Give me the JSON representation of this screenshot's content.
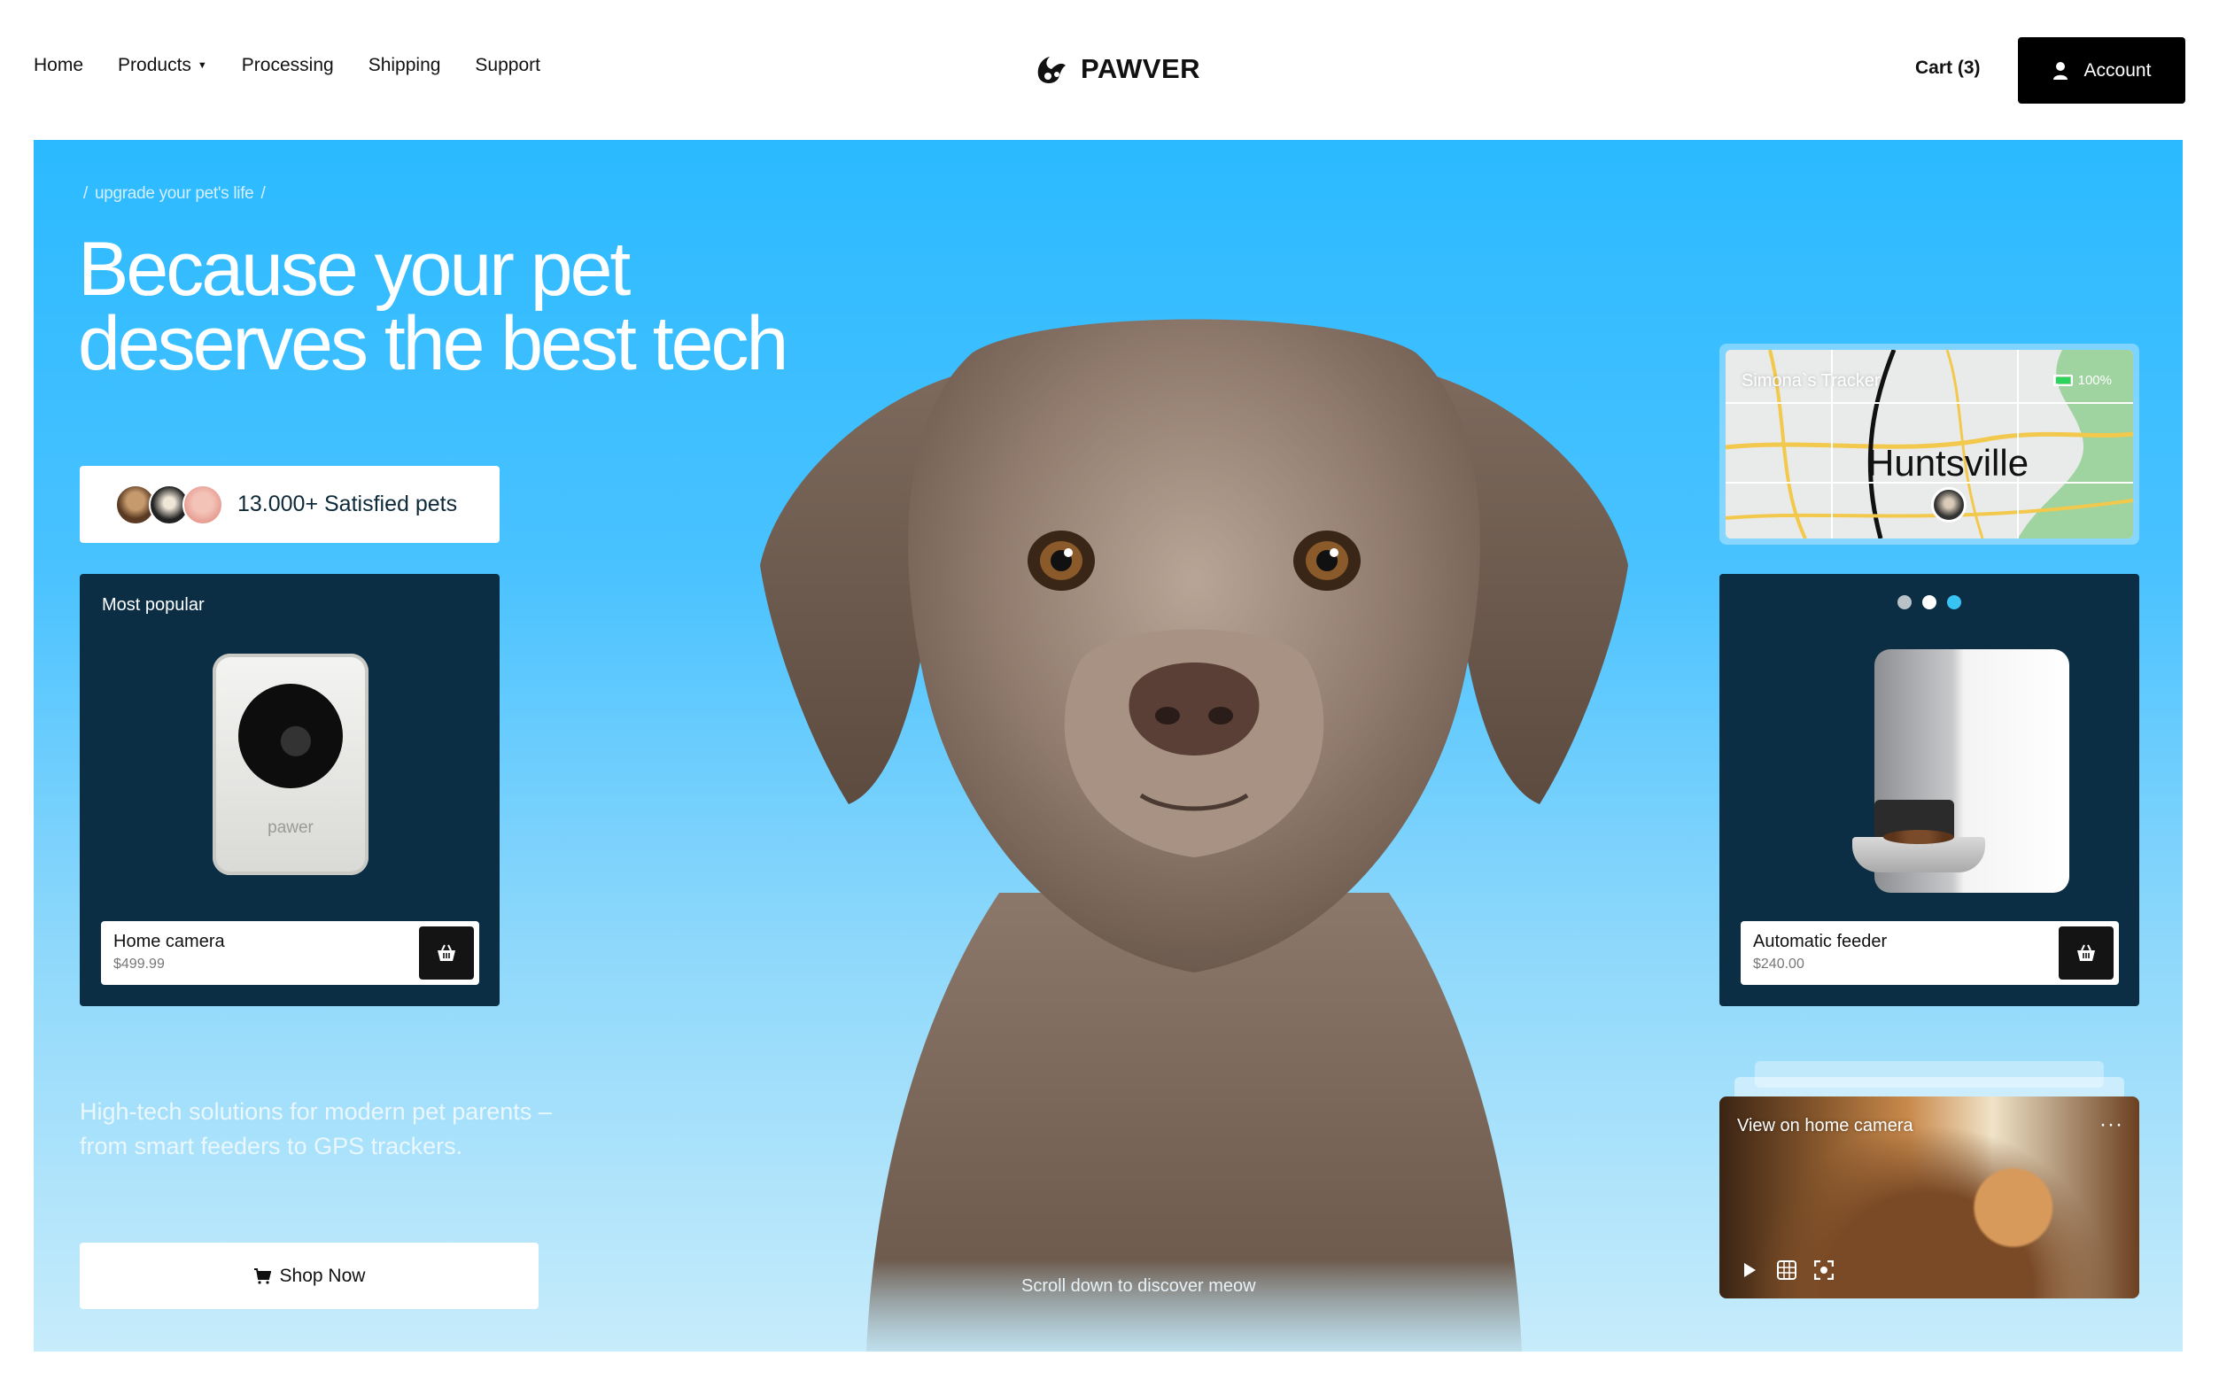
{
  "nav": {
    "items": [
      "Home",
      "Products",
      "Processing",
      "Shipping",
      "Support"
    ]
  },
  "brand": {
    "name": "PAWVER"
  },
  "header": {
    "cart_label": "Cart (3)",
    "account_label": "Account"
  },
  "hero": {
    "breadcrumb": [
      "/",
      "upgrade your pet's life",
      "/"
    ],
    "headline_line1": "Because your pet",
    "headline_line2": "deserves the best tech",
    "satisfied_pets": "13.000+ Satisfied pets",
    "tagline": "High-tech solutions for modern pet parents – from smart feeders to GPS trackers.",
    "shop_label": "Shop Now",
    "scroll_hint": "Scroll down to discover meow"
  },
  "products": {
    "left": {
      "tag": "Most popular",
      "name": "Home camera",
      "price": "$499.99",
      "device_brand": "pawer"
    },
    "right": {
      "name": "Automatic feeder",
      "price": "$240.00"
    }
  },
  "tracker": {
    "title": "Simona`s Tracker",
    "battery": "100%",
    "city": "Huntsville"
  },
  "video": {
    "title": "View on home camera",
    "more": "···"
  },
  "colors": {
    "hero_top": "#2bbaff",
    "hero_bottom": "#c7ecfb",
    "card_bg": "#0b2e45",
    "button_dark": "#000000",
    "carousel_dots": [
      "#b9c2c8",
      "#ffffff",
      "#38c3f2"
    ]
  },
  "icons": [
    "paw-logo-icon",
    "user-icon",
    "basket-icon",
    "cart-icon",
    "play-icon",
    "grid-icon",
    "fullscreen-icon",
    "more-icon",
    "battery-icon",
    "map-pin-avatar-icon"
  ]
}
